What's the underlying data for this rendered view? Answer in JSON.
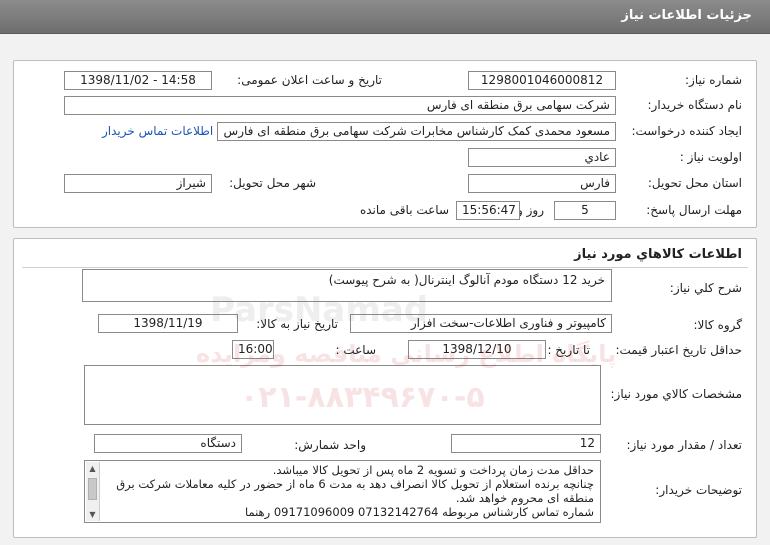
{
  "header": {
    "title": "جزئيات اطلاعات نياز"
  },
  "info": {
    "need_number_label": "شماره نياز:",
    "need_number": "1298001046000812",
    "announce_label": "تاريخ و ساعت اعلان عمومی:",
    "announce_value": "1398/11/02 - 14:58",
    "buyer_label": "نام دستگاه خريدار:",
    "buyer_value": "شرکت سهامی برق منطقه ای فارس",
    "creator_label": "ايجاد کننده درخواست:",
    "creator_value": "مسعود محمدی کمک کارشناس مخابرات شرکت سهامی برق منطقه ای فارس",
    "contact_link": "اطلاعات تماس خريدار",
    "priority_label": "اولويت نياز :",
    "priority_value": "عادي",
    "province_label": "استان محل تحويل:",
    "province_value": "فارس",
    "city_label": "شهر محل تحويل:",
    "city_value": "شيراز",
    "deadline_label": "مهلت ارسال پاسخ:",
    "days_value": "5",
    "days_label": "روز و",
    "time_value": "15:56:47",
    "remaining_label": "ساعت باقی مانده"
  },
  "goods": {
    "title": "اطلاعات کالاهاي مورد نياز",
    "desc_label": "شرح کلي نياز:",
    "desc_value": "خريد 12 دستگاه مودم آنالوگ اينترنال( به شرح پيوست)",
    "group_label": "گروه کالا:",
    "group_value": "کامپيوتر و فناوری اطلاعات-سخت افزار",
    "need_date_label": "تاريخ نياز به کالا:",
    "need_date_value": "1398/11/19",
    "validity_label": "حداقل تاريخ اعتبار قيمت:",
    "to_date_label": "تا تاريخ :",
    "to_date_value": "1398/12/10",
    "hour_label": "ساعت :",
    "hour_value": "16:00",
    "specs_label": "مشخصات کالاي مورد نياز:",
    "specs_value": "",
    "qty_label": "تعداد / مقدار مورد نياز:",
    "qty_value": "12",
    "unit_label": "واحد شمارش:",
    "unit_value": "دستگاه",
    "notes_label": "توضيحات خريدار:",
    "notes_lines": [
      "حداقل مدت زمان پرداخت و تسويه 2 ماه پس از تحويل کالا ميباشد.",
      "چنانچه برنده استعلام از تحويل کالا انصراف دهد به مدت 6 ماه از حضور در کليه معاملات شرکت برق",
      "منطقه ای محروم خواهد شد.",
      "شماره تماس کارشناس مربوطه 07132142764   09171096009   رهنما"
    ]
  },
  "watermark": {
    "brand": "ParsNamad",
    "line1": "پايگاه اطلاع رسانی مناقصه ومزايده",
    "phone": "۰۲۱-۸۸۳۴۹۶۷۰-۵"
  }
}
